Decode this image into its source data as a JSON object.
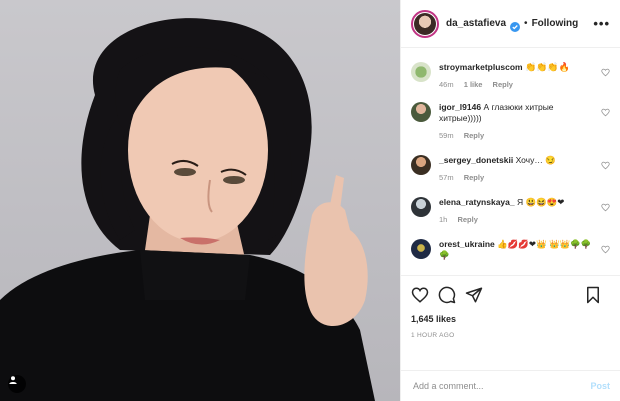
{
  "header": {
    "username": "da_astafieva",
    "separator": "•",
    "follow_label": "Following",
    "more_label": "•••"
  },
  "comments": [
    {
      "user": "stroymarketpluscom",
      "text": "👏👏👏🔥",
      "time": "46m",
      "likes": "1 like",
      "reply": "Reply"
    },
    {
      "user": "igor_l9146",
      "text": "А глазюки хитрые хитрые)))))",
      "time": "59m",
      "likes": "",
      "reply": "Reply"
    },
    {
      "user": "_sergey_donetskii",
      "text": "Хочу… 😏",
      "time": "57m",
      "likes": "",
      "reply": "Reply"
    },
    {
      "user": "elena_ratynskaya_",
      "text": "Я 😃😆😍❤",
      "time": "1h",
      "likes": "",
      "reply": "Reply"
    },
    {
      "user": "orest_ukraine",
      "text": "👍💋💋❤👑 👑👑🌳🌳🌳",
      "time": "",
      "likes": "",
      "reply": ""
    }
  ],
  "actions": {
    "likes": "1,645 likes",
    "time": "1 HOUR AGO"
  },
  "add_comment": {
    "placeholder": "Add a comment...",
    "post_label": "Post"
  },
  "colors": {
    "accent": "#0095f6",
    "post_disabled": "#b2dffc",
    "meta_text": "#8e8e8e",
    "border": "#efefef"
  },
  "icons": [
    "tag-user-icon",
    "verified-badge-icon",
    "heart-icon",
    "comment-icon",
    "share-icon",
    "bookmark-icon"
  ]
}
